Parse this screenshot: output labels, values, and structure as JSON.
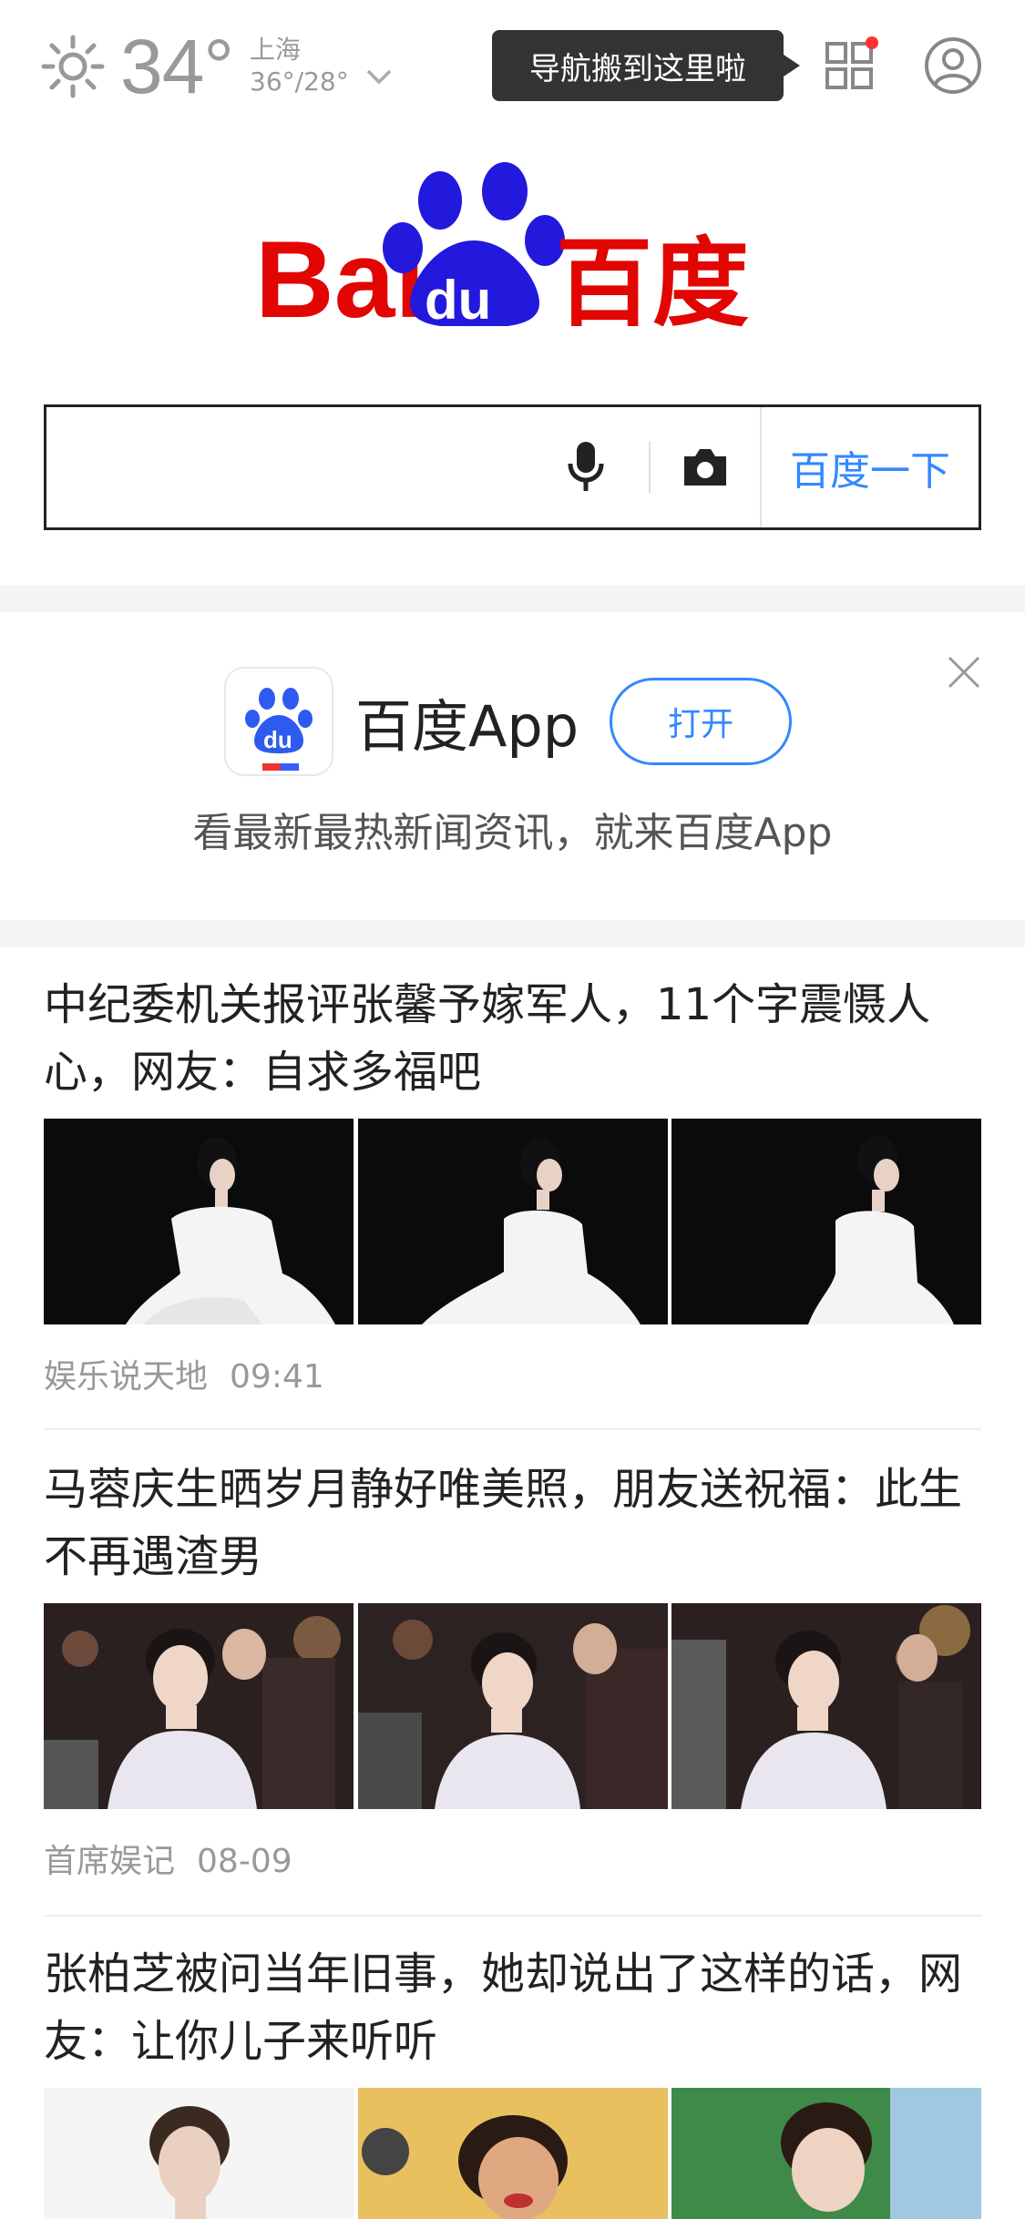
{
  "weather": {
    "temperature": "34°",
    "city": "上海",
    "range": "36°/28°"
  },
  "tooltip": "导航搬到这里啦",
  "search": {
    "button_label": "百度一下",
    "value": "",
    "placeholder": ""
  },
  "promo": {
    "app_name": "百度App",
    "open_label": "打开",
    "description": "看最新最热新闻资讯，就来百度App"
  },
  "news": [
    {
      "title": "中纪委机关报评张馨予嫁军人，11个字震慑人心，网友：自求多福吧",
      "source": "娱乐说天地",
      "time": "09:41"
    },
    {
      "title": "马蓉庆生晒岁月静好唯美照，朋友送祝福：此生不再遇渣男",
      "source": "首席娱记",
      "time": "08-09"
    },
    {
      "title": "张柏芝被问当年旧事，她却说出了这样的话，网友：让你儿子来听听",
      "source": "",
      "time": ""
    }
  ],
  "colors": {
    "accent": "#3388ff",
    "logo_red": "#e10601",
    "logo_blue": "#2319dc",
    "badge": "#ff3333"
  }
}
